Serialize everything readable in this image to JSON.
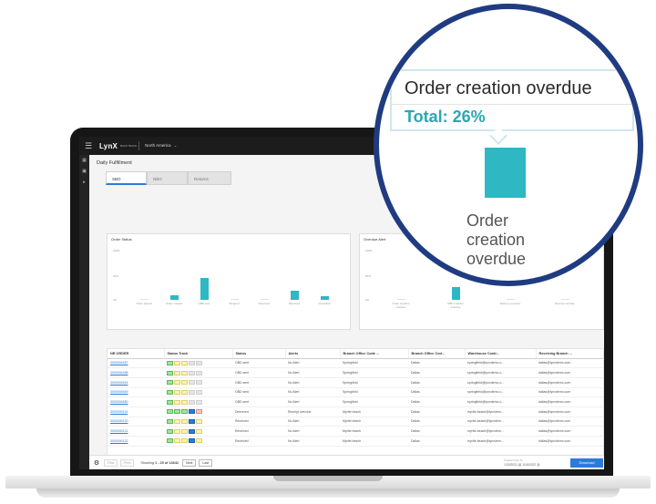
{
  "app": {
    "brand": "LynX",
    "brand_sub": "BACKTRACK",
    "region": "North America",
    "page_title": "Daily Fulfillment",
    "tabs": [
      "SBO",
      "NBO",
      "Returns"
    ]
  },
  "nav_icons": [
    "grid-icon",
    "box-icon",
    "truck-icon"
  ],
  "colors": {
    "bar": "#2fb7c4",
    "link": "#2b7bd8",
    "callout_border": "#1f3b82",
    "total_text": "#2aa7b3"
  },
  "order_status": {
    "title": "Order Status",
    "y_ticks": [
      "100%",
      "50%",
      "0%"
    ],
    "categories": [
      {
        "label": "Order placed",
        "value": 1
      },
      {
        "label": "Order created",
        "value": 10
      },
      {
        "label": "OBD sent",
        "value": 44
      },
      {
        "label": "Shipped",
        "value": 1
      },
      {
        "label": "Delivered",
        "value": 1
      },
      {
        "label": "Received",
        "value": 19
      },
      {
        "label": "Cancelled",
        "value": 8
      }
    ]
  },
  "overdue_alert": {
    "title": "Overdue Alert",
    "y_ticks": [
      "100%",
      "50%",
      "0%"
    ],
    "categories": [
      {
        "label": "Order creation overdue",
        "value": 0
      },
      {
        "label": "OBD creation overdue",
        "value": 26
      },
      {
        "label": "Delivery overdue",
        "value": 0
      },
      {
        "label": "Receipt overdue",
        "value": 0
      }
    ]
  },
  "table": {
    "columns": [
      "NR ORDER",
      "Status Track",
      "Status",
      "Alerts",
      "Branch Office Code ...",
      "Branch Office Cod...",
      "Warehouse Contr...",
      "Receiving Branch ..."
    ],
    "rows": [
      {
        "order": "3000004457",
        "track": [
          "green",
          "yellow",
          "yellow",
          "grey",
          "grey"
        ],
        "status": "OBD sent",
        "alerts": "No Alert",
        "branch_code": "Springfield",
        "branch_code2": "Dallas",
        "warehouse": "springfield@lynxdemo.c...",
        "receiving": "dallas@lynxdemo.com"
      },
      {
        "order": "3000004458",
        "track": [
          "green",
          "yellow",
          "yellow",
          "grey",
          "grey"
        ],
        "status": "OBD sent",
        "alerts": "No Alert",
        "branch_code": "Springfield",
        "branch_code2": "Dallas",
        "warehouse": "springfield@lynxdemo.c...",
        "receiving": "dallas@lynxdemo.com"
      },
      {
        "order": "3000004524",
        "track": [
          "green",
          "yellow",
          "yellow",
          "grey",
          "grey"
        ],
        "status": "OBD sent",
        "alerts": "No Alert",
        "branch_code": "Springfield",
        "branch_code2": "Dallas",
        "warehouse": "springfield@lynxdemo.c...",
        "receiving": "dallas@lynxdemo.com"
      },
      {
        "order": "3000004549",
        "track": [
          "green",
          "yellow",
          "yellow",
          "grey",
          "grey"
        ],
        "status": "OBD sent",
        "alerts": "No Alert",
        "branch_code": "Springfield",
        "branch_code2": "Dallas",
        "warehouse": "springfield@lynxdemo.c...",
        "receiving": "dallas@lynxdemo.com"
      },
      {
        "order": "3000004550",
        "track": [
          "green",
          "yellow",
          "yellow",
          "grey",
          "grey"
        ],
        "status": "OBD sent",
        "alerts": "No Alert",
        "branch_code": "Springfield",
        "branch_code2": "Dallas",
        "warehouse": "springfield@lynxdemo.c...",
        "receiving": "dallas@lynxdemo.com"
      },
      {
        "order": "3000000119",
        "track": [
          "green",
          "green",
          "green",
          "blue",
          "red"
        ],
        "status": "Delivered",
        "alerts": "Receipt overdue",
        "branch_code": "Myrtle beach",
        "branch_code2": "Dallas",
        "warehouse": "myrtle-beach@lynxdem...",
        "receiving": "dallas@lynxdemo.com"
      },
      {
        "order": "3000000120",
        "track": [
          "green",
          "yellow",
          "yellow",
          "blue",
          "yellow"
        ],
        "status": "Received",
        "alerts": "No Alert",
        "branch_code": "Myrtle beach",
        "branch_code2": "Dallas",
        "warehouse": "myrtle-beach@lynxdem...",
        "receiving": "dallas@lynxdemo.com"
      },
      {
        "order": "3000000121",
        "track": [
          "green",
          "yellow",
          "yellow",
          "blue",
          "yellow"
        ],
        "status": "Received",
        "alerts": "No Alert",
        "branch_code": "Myrtle beach",
        "branch_code2": "Dallas",
        "warehouse": "myrtle-beach@lynxdem...",
        "receiving": "dallas@lynxdemo.com"
      },
      {
        "order": "3000000122",
        "track": [
          "green",
          "yellow",
          "yellow",
          "blue",
          "yellow"
        ],
        "status": "Received",
        "alerts": "No Alert",
        "branch_code": "Myrtle beach",
        "branch_code2": "Dallas",
        "warehouse": "myrtle-beach@lynxdem...",
        "receiving": "dallas@lynxdemo.com"
      }
    ]
  },
  "footer": {
    "first": "First",
    "prev": "Prev",
    "showing_prefix": "Showing",
    "showing_range": "1 - 25 of 13642",
    "next": "Next",
    "last": "Last",
    "date_label": "Creation from  To",
    "date_from": "1/20/2021",
    "date_to": "1/18/2022",
    "download": "Download"
  },
  "callout": {
    "title": "Order creation overdue",
    "total": "Total: 26%",
    "bar_label": "Order creation overdue"
  }
}
